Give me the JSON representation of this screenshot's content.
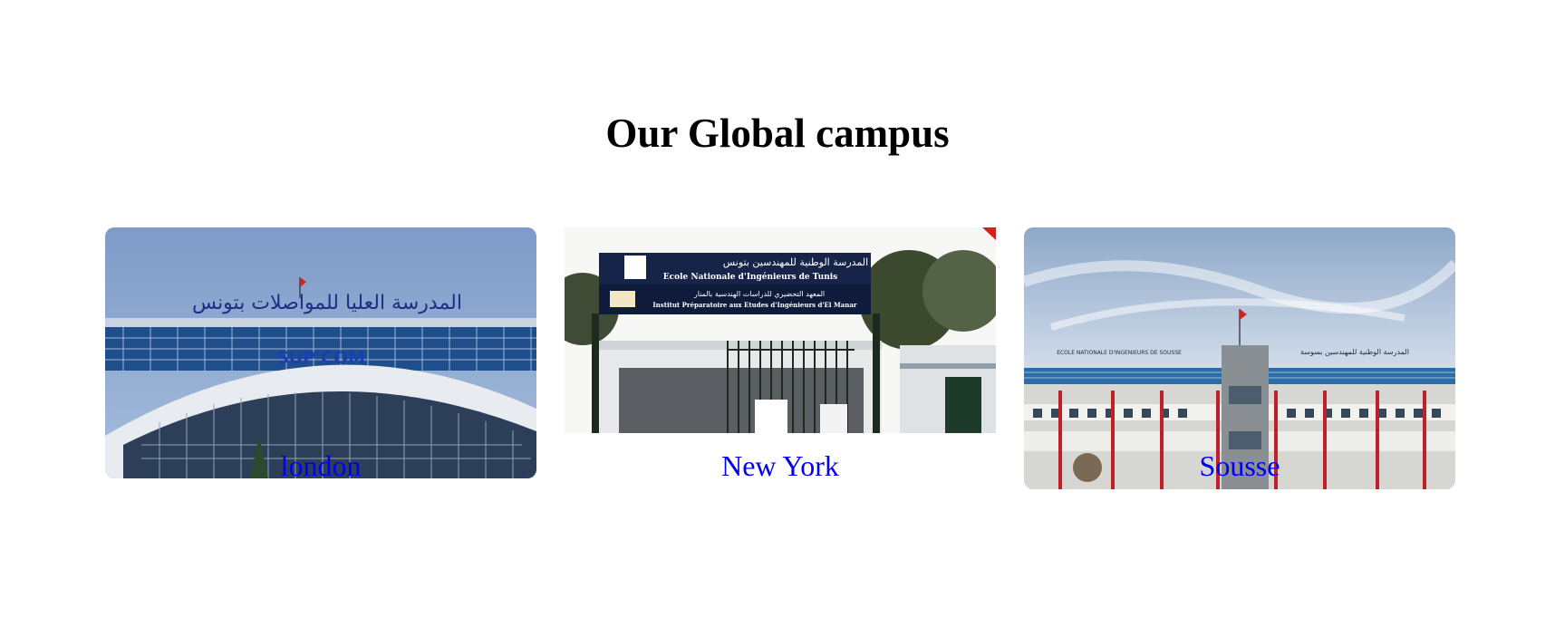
{
  "section": {
    "title": "Our Global campus"
  },
  "campuses": [
    {
      "name": "london",
      "photo_signage_arabic": "المدرسة العليا للمواصلات بتونس",
      "photo_signage_logo": "SUP'COM"
    },
    {
      "name": "New York",
      "photo_signage_arabic": "المدرسة الوطنية للمهندسين بتونس",
      "photo_signage_french": "Ecole Nationale d'Ingénieurs de Tunis",
      "photo_signage_arabic_2": "المعهد التحضيري للدراسات الهندسية بالمنار",
      "photo_signage_french_2": "Institut Préparatoire aux Etudes d'Ingénieurs d'El Manar"
    },
    {
      "name": "Sousse",
      "photo_signage_french": "ECOLE NATIONALE D'INGENIEURS DE SOUSSE",
      "photo_signage_arabic": "المدرسة الوطنية للمهندسين بسوسة"
    }
  ],
  "colors": {
    "link": "#0000ee",
    "heading": "#000000",
    "background": "#ffffff"
  }
}
